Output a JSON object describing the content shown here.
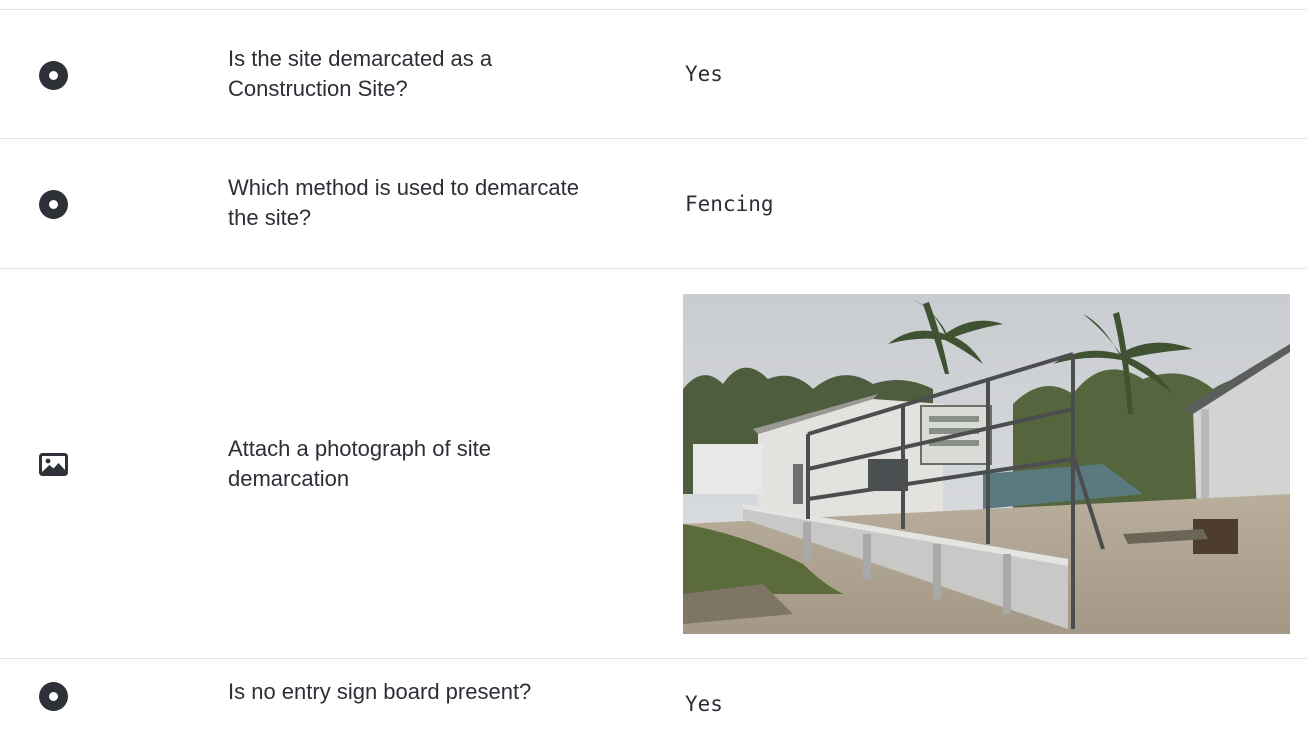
{
  "rows": [
    {
      "icon": "radio-icon",
      "question": "Is the site demarcated as a Construction Site?",
      "answer": "Yes"
    },
    {
      "icon": "radio-icon",
      "question": "Which method is used to demarcate the site?",
      "answer": "Fencing"
    },
    {
      "icon": "image-icon",
      "question": "Attach a photograph of site demarcation"
    },
    {
      "icon": "radio-icon",
      "question": "Is no entry sign board present?",
      "answer": "Yes"
    }
  ]
}
